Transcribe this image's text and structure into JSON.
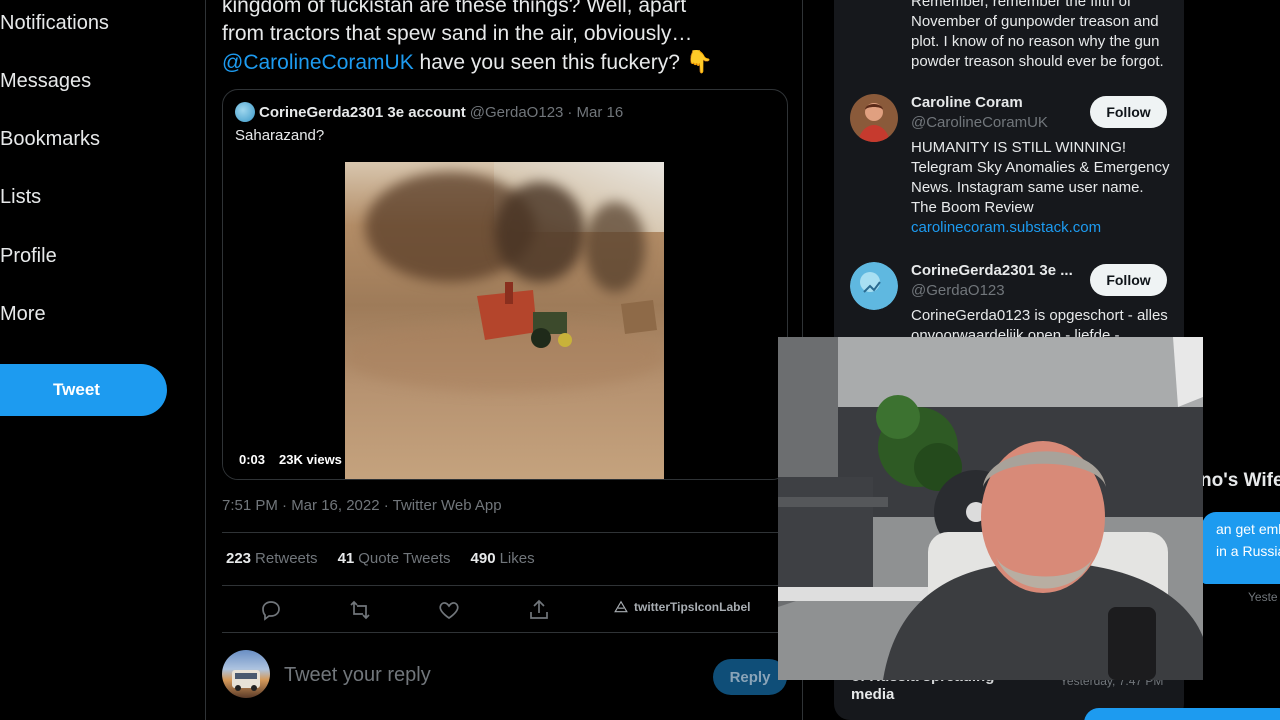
{
  "nav": {
    "items": [
      {
        "label": "Notifications"
      },
      {
        "label": "Messages"
      },
      {
        "label": "Bookmarks"
      },
      {
        "label": "Lists"
      },
      {
        "label": "Profile"
      },
      {
        "label": "More"
      }
    ],
    "tweet_button": "Tweet"
  },
  "tweet": {
    "text_line1": "kingdom of fuckistan are these things? Well, apart",
    "text_line2": "from tractors that spew sand in the air, obviously…",
    "mention": "@CarolineCoramUK",
    "text_tail": " have you seen this fuckery?",
    "emoji": "👇",
    "quote": {
      "name": "CorineGerda2301 3e account",
      "handle": "@GerdaO123",
      "date": "· Mar 16",
      "text": "Saharazand?",
      "video_time": "0:03",
      "video_views": "23K views"
    },
    "timestamp": "7:51 PM · Mar 16, 2022 · Twitter Web App",
    "stats": {
      "retweets_count": "223",
      "retweets_label": "Retweets",
      "quotes_count": "41",
      "quotes_label": "Quote Tweets",
      "likes_count": "490",
      "likes_label": "Likes"
    },
    "tips_label": "twitterTipsIconLabel",
    "reply_placeholder": "Tweet your reply",
    "reply_button": "Reply"
  },
  "sidebar": {
    "top_text": "Remember, remember the fifth of November of gunpowder treason and plot. I know of no reason why the gun powder treason should ever be forgot.",
    "users": [
      {
        "name": "Caroline Coram",
        "handle": "@CarolineCoramUK",
        "bio": "HUMANITY IS STILL WINNING! Telegram Sky Anomalies & Emergency News. Instagram same user name. The Boom Review",
        "link": "carolinecoram.substack.com",
        "follow": "Follow"
      },
      {
        "name": "CorineGerda2301 3e ...",
        "handle": "@GerdaO123",
        "bio": "CorineGerda0123 is opgeschort - alles onvoorwaardelijk open - liefde -",
        "follow": "Follow"
      }
    ],
    "bottom_pre": "of Russia spreading",
    "bottom_text": "media",
    "bottom_time": "Yesterday, 7:47 PM"
  },
  "dm": {
    "title": "no's Wife",
    "line1": "an get embe",
    "line2": "in a Russian",
    "time": "Yeste"
  }
}
